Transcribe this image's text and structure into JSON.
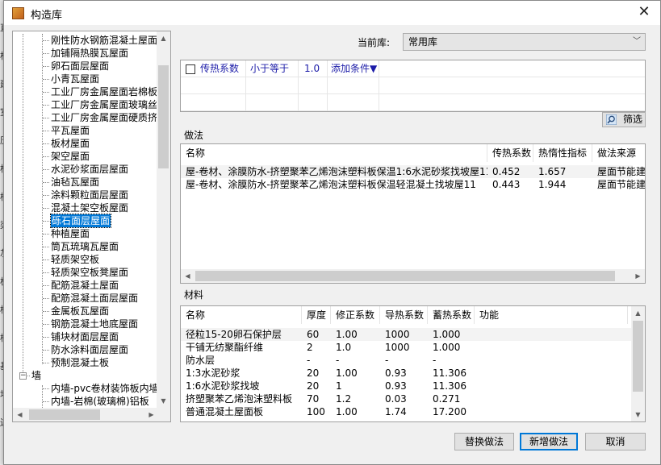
{
  "window": {
    "title": "构造库",
    "close_glyph": "✕"
  },
  "background_strip": [
    "直",
    "构",
    "建",
    "室",
    "历",
    "柱",
    "楼",
    "梁",
    "灰",
    "板",
    "楼",
    "楼",
    "基",
    "地",
    "边"
  ],
  "tree": {
    "items": [
      {
        "label": "刚性防水钢筋混凝土屋面",
        "level": 2
      },
      {
        "label": "加铺隔热膜瓦屋面",
        "level": 2
      },
      {
        "label": "卵石面层屋面",
        "level": 2
      },
      {
        "label": "小青瓦屋面",
        "level": 2
      },
      {
        "label": "工业厂房金属屋面岩棉板",
        "level": 2
      },
      {
        "label": "工业厂房金属屋面玻璃丝",
        "level": 2
      },
      {
        "label": "工业厂房金属屋面硬质挤",
        "level": 2
      },
      {
        "label": "平瓦屋面",
        "level": 2
      },
      {
        "label": "板材屋面",
        "level": 2
      },
      {
        "label": "架空屋面",
        "level": 2
      },
      {
        "label": "水泥砂浆面层屋面",
        "level": 2
      },
      {
        "label": "油毡瓦屋面",
        "level": 2
      },
      {
        "label": "涂料颗粒面层屋面",
        "level": 2
      },
      {
        "label": "混凝土架空板屋面",
        "level": 2
      },
      {
        "label": "砾石面层屋面",
        "level": 2,
        "selected": true
      },
      {
        "label": "种植屋面",
        "level": 2
      },
      {
        "label": "筒瓦琉璃瓦屋面",
        "level": 2
      },
      {
        "label": "轻质架空板",
        "level": 2
      },
      {
        "label": "轻质架空板凳屋面",
        "level": 2
      },
      {
        "label": "配筋混凝土屋面",
        "level": 2
      },
      {
        "label": "配筋混凝土面层屋面",
        "level": 2
      },
      {
        "label": "金属板瓦屋面",
        "level": 2
      },
      {
        "label": "钢筋混凝土地底屋面",
        "level": 2
      },
      {
        "label": "铺块材面层屋面",
        "level": 2
      },
      {
        "label": "防水涂料面层屋面",
        "level": 2
      },
      {
        "label": "预制混凝土板",
        "level": 2
      },
      {
        "label": "墙",
        "level": 1,
        "toggle": "−"
      },
      {
        "label": "内墙-pvc卷材装饰板内墙",
        "level": 2
      },
      {
        "label": "内墙-岩棉(玻璃棉)铝板",
        "level": 2
      }
    ],
    "toggle_expand": "−"
  },
  "library": {
    "label": "当前库:",
    "value": "常用库"
  },
  "condition": {
    "field": "传热系数",
    "operator": "小于等于",
    "value": "1.0",
    "add_label": "添加条件▼"
  },
  "filter_button": "筛选",
  "methods": {
    "section_label": "做法",
    "columns": [
      "名称",
      "传热系数",
      "热惰性指标",
      "做法来源"
    ],
    "rows": [
      [
        "屋-卷材、涂膜防水-挤塑聚苯乙烯泡沫塑料板保温1:6水泥砂浆找坡屋11",
        "0.452",
        "1.657",
        "屋面节能建"
      ],
      [
        "屋-卷材、涂膜防水-挤塑聚苯乙烯泡沫塑料板保温轻混凝土找坡屋11",
        "0.443",
        "1.944",
        "屋面节能建"
      ]
    ]
  },
  "materials": {
    "section_label": "材料",
    "columns": [
      "名称",
      "厚度",
      "修正系数",
      "导热系数",
      "蓄热系数",
      "功能"
    ],
    "rows": [
      [
        "径粒15-20卵石保护层",
        "60",
        "1.00",
        "1000",
        "1.000",
        ""
      ],
      [
        "干铺无纺聚酯纤维",
        "2",
        "1.0",
        "1000",
        "1.000",
        ""
      ],
      [
        "防水层",
        "-",
        "-",
        "-",
        "-",
        ""
      ],
      [
        "1:3水泥砂浆",
        "20",
        "1.00",
        "0.93",
        "11.306",
        ""
      ],
      [
        "1:6水泥砂浆找坡",
        "20",
        "1",
        "0.93",
        "11.306",
        ""
      ],
      [
        "挤塑聚苯乙烯泡沫塑料板",
        "70",
        "1.2",
        "0.03",
        "0.271",
        ""
      ],
      [
        "普通混凝土屋面板",
        "100",
        "1.00",
        "1.74",
        "17.200",
        ""
      ]
    ]
  },
  "buttons": {
    "replace": "替换做法",
    "add": "新增做法",
    "cancel": "取消"
  },
  "colors": {
    "selection": "#0078d7",
    "condition_text": "#1c1ca8"
  },
  "icons": {
    "close": "close-icon",
    "app": "app-icon",
    "filter": "magnifier-icon"
  }
}
